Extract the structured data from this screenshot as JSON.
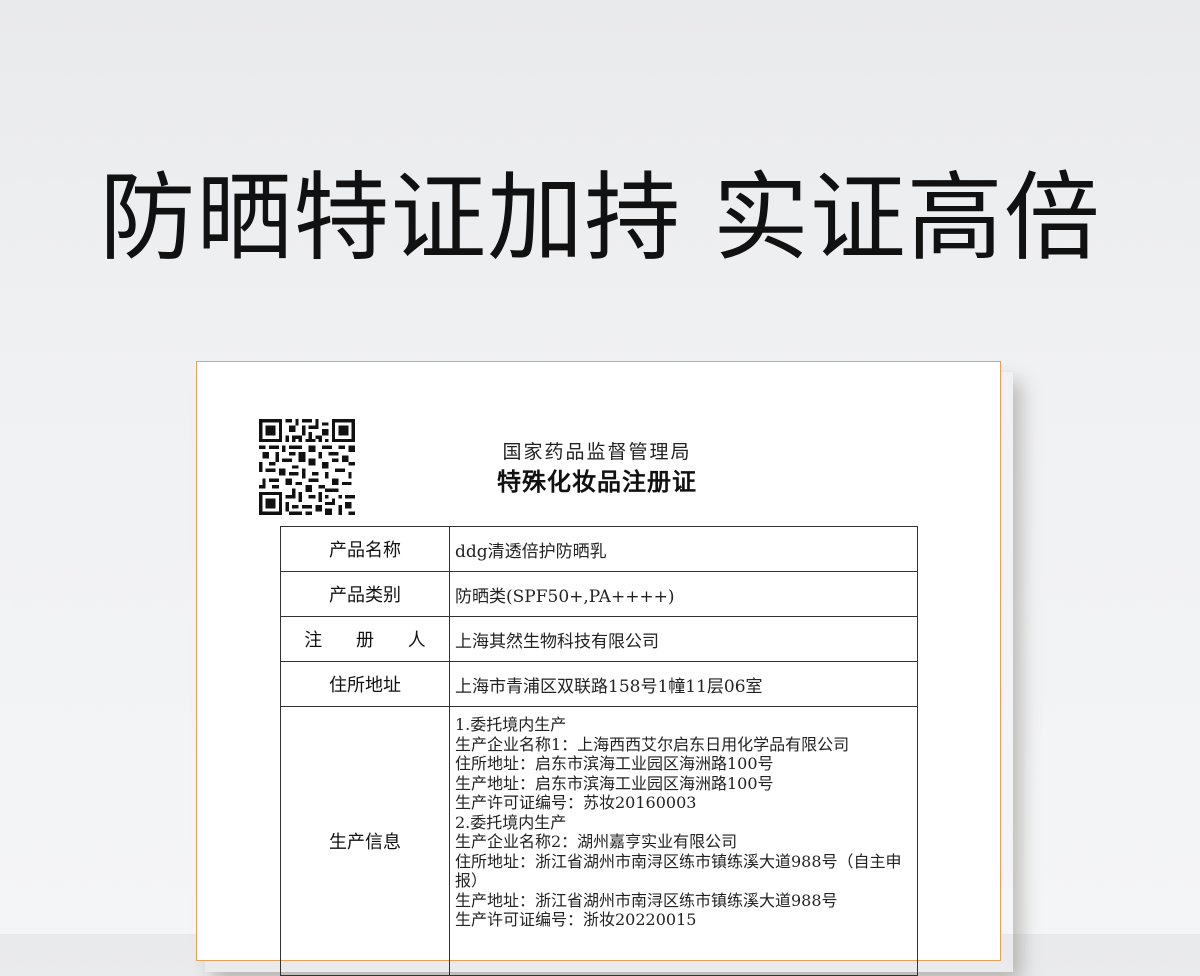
{
  "headline": "防晒特证加持 实证高倍",
  "certificate": {
    "issuer": "国家药品监督管理局",
    "title": "特殊化妆品注册证",
    "rows": [
      {
        "label": "产品名称",
        "value": "ddg清透倍护防晒乳"
      },
      {
        "label": "产品类别",
        "value": "防晒类(SPF50+,PA++++)"
      },
      {
        "label": "注 册 人",
        "value": "上海其然生物科技有限公司"
      },
      {
        "label": "住所地址",
        "value": "上海市青浦区双联路158号1幢11层06室"
      }
    ],
    "production": {
      "label": "生产信息",
      "lines": [
        "1.委托境内生产",
        "生产企业名称1：上海西西艾尔启东日用化学品有限公司",
        "住所地址：启东市滨海工业园区海洲路100号",
        "生产地址：启东市滨海工业园区海洲路100号",
        "生产许可证编号：苏妆20160003",
        "2.委托境内生产",
        "生产企业名称2：湖州嘉亨实业有限公司",
        "住所地址：浙江省湖州市南浔区练市镇练溪大道988号（自主申报）",
        "生产地址：浙江省湖州市南浔区练市镇练溪大道988号",
        "生产许可证编号：浙妆20220015"
      ]
    },
    "qr_icon": "qr-code-icon",
    "border_color": "#e5a25a"
  }
}
